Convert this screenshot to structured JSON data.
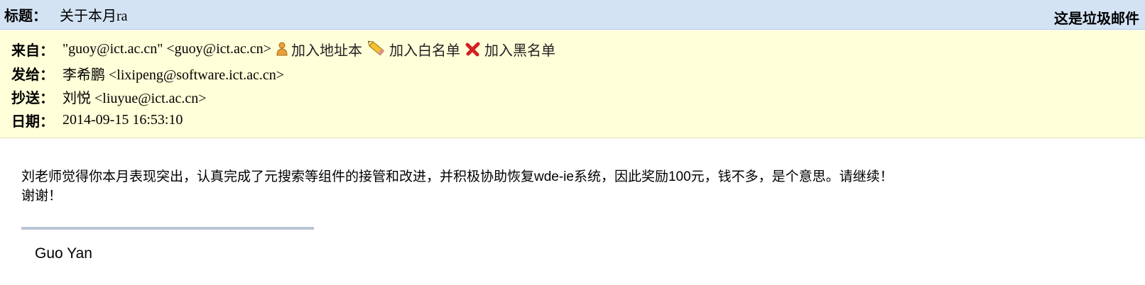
{
  "subject": {
    "label": "标题：",
    "text": "关于本月ra",
    "spam_link": "这是垃圾邮件"
  },
  "header": {
    "from": {
      "label": "来自：",
      "value": "\"guoy@ict.ac.cn\" <guoy@ict.ac.cn>",
      "actions": {
        "add_contact": "加入地址本",
        "add_whitelist": "加入白名单",
        "add_blacklist": "加入黑名单"
      }
    },
    "to": {
      "label": "发给：",
      "value": "李希鹏 <lixipeng@software.ict.ac.cn>"
    },
    "cc": {
      "label": "抄送：",
      "value": "刘悦 <liuyue@ict.ac.cn>"
    },
    "date": {
      "label": "日期：",
      "value": "2014-09-15 16:53:10"
    }
  },
  "body": {
    "line1": "刘老师觉得你本月表现突出，认真完成了元搜索等组件的接管和改进，并积极协助恢复wde-ie系统，因此奖励100元，钱不多，是个意思。请继续！",
    "line2": "谢谢！"
  },
  "signature": "Guo Yan",
  "icons": {
    "add_contact": "person-icon",
    "add_whitelist": "pencil-icon",
    "add_blacklist": "red-x-icon"
  }
}
